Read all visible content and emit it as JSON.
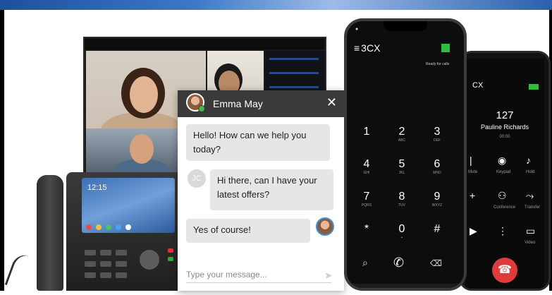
{
  "chat": {
    "agent_name": "Emma May",
    "close_icon": "✕",
    "messages": [
      {
        "from": "agent",
        "text": "Hello! How can we help you today?"
      },
      {
        "from": "customer",
        "avatar_initials": "JC",
        "text": "Hi there, can I have your latest offers?"
      },
      {
        "from": "agent",
        "text": "Yes of course!"
      }
    ],
    "input_placeholder": "Type your message...",
    "send_icon": "send-icon"
  },
  "desk_phone": {
    "clock": "12:15"
  },
  "softphone_front": {
    "app_name": "3CX",
    "logo_prefix": "≡",
    "status_text": "Ready for calls",
    "keypad": [
      {
        "num": "1",
        "sub": ""
      },
      {
        "num": "2",
        "sub": "ABC"
      },
      {
        "num": "3",
        "sub": "DEF"
      },
      {
        "num": "4",
        "sub": "GHI"
      },
      {
        "num": "5",
        "sub": "JKL"
      },
      {
        "num": "6",
        "sub": "MNO"
      },
      {
        "num": "7",
        "sub": "PQRS"
      },
      {
        "num": "8",
        "sub": "TUV"
      },
      {
        "num": "9",
        "sub": "WXYZ"
      },
      {
        "num": "*",
        "sub": ""
      },
      {
        "num": "0",
        "sub": "+"
      },
      {
        "num": "#",
        "sub": ""
      }
    ]
  },
  "softphone_back": {
    "app_name": "CX",
    "extension": "127",
    "caller_name": "Pauline Richards",
    "call_state": "00:00",
    "controls": [
      "Mute",
      "Keypad",
      "Hold",
      "Conference",
      "Transfer",
      "Video"
    ]
  },
  "colors": {
    "chat_header": "#3a3a3a",
    "bubble": "#e6e6e6",
    "status_green": "#2fbf3a",
    "hangup_red": "#e03b3b",
    "brand_blue": "#3f8fe0"
  }
}
